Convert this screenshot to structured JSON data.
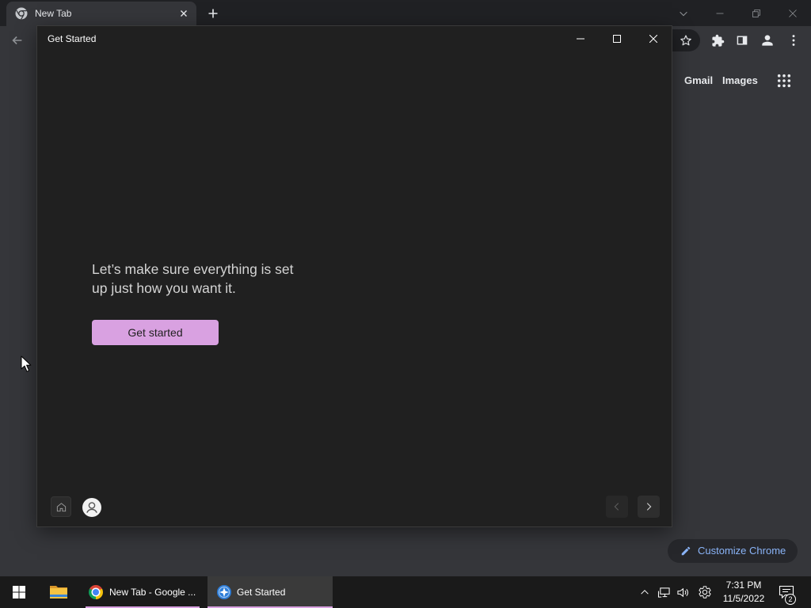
{
  "colors": {
    "tabstrip_bg": "#202124",
    "page_bg": "#35363a",
    "window_bg": "#202020",
    "taskbar_bg": "#1a1a1a",
    "accent": "#d9a1e1",
    "link_blue": "#8ab4f8"
  },
  "browser": {
    "tab": {
      "title": "New Tab",
      "favicon": "chrome-icon",
      "close_icon": "close-icon"
    },
    "new_tab_icon": "plus-icon",
    "window_controls": [
      "chevron-down-icon",
      "minimize-icon",
      "restore-icon",
      "close-icon"
    ],
    "toolbar_icons": [
      "back-arrow-icon",
      "star-icon",
      "extensions-icon",
      "side-panel-icon",
      "profile-icon",
      "more-menu-icon"
    ],
    "ntp": {
      "gmail_link": "Gmail",
      "images_link": "Images",
      "apps_icon": "apps-grid-icon",
      "customize_button": {
        "label": "Customize Chrome",
        "icon": "pencil-icon"
      }
    }
  },
  "dialog": {
    "title": "Get Started",
    "window_controls": [
      "minimize-icon",
      "maximize-icon",
      "close-icon"
    ],
    "heading": "Let’s make sure everything is set up just how you want it.",
    "primary_button": "Get started",
    "footer_icons": [
      "home-icon",
      "user-avatar-icon",
      "chevron-left-icon",
      "chevron-right-icon"
    ],
    "nav": {
      "previous_enabled": false,
      "next_enabled": true
    }
  },
  "taskbar": {
    "start_icon": "windows-logo-icon",
    "explorer_icon": "folder-icon",
    "apps": [
      {
        "icon": "chrome-icon",
        "label": "New Tab - Google ...",
        "active": false
      },
      {
        "icon": "get-started-icon",
        "label": "Get Started",
        "active": true
      }
    ],
    "tray_icons": [
      "chevron-up-icon",
      "network-icon",
      "volume-icon",
      "settings-icon"
    ],
    "clock": {
      "time": "7:31 PM",
      "date": "11/5/2022"
    },
    "notifications": {
      "icon": "notification-icon",
      "count": "2"
    }
  }
}
